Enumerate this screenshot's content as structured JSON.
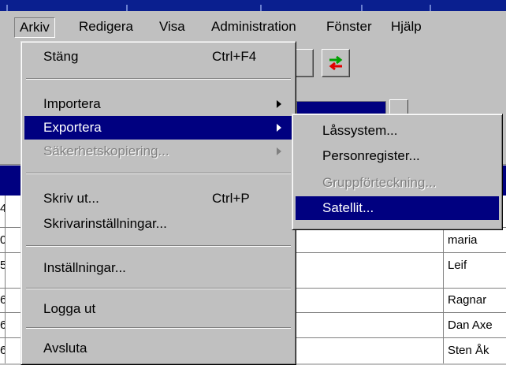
{
  "menubar": {
    "items": [
      "Arkiv",
      "Redigera",
      "Visa",
      "Administration",
      "Fönster",
      "Hjälp"
    ],
    "active": "Arkiv"
  },
  "arkiv_menu": {
    "close": {
      "label": "Stäng",
      "shortcut": "Ctrl+F4"
    },
    "import": {
      "label": "Importera"
    },
    "export": {
      "label": "Exportera"
    },
    "backup": {
      "label": "Säkerhetskopiering..."
    },
    "print": {
      "label": "Skriv ut...",
      "shortcut": "Ctrl+P"
    },
    "printer_settings": {
      "label": "Skrivarinställningar..."
    },
    "settings": {
      "label": "Inställningar..."
    },
    "logout": {
      "label": "Logga ut"
    },
    "exit": {
      "label": "Avsluta"
    }
  },
  "export_submenu": {
    "lock_system": "Låssystem...",
    "person_register": "Personregister...",
    "group_listing": "Gruppförteckning...",
    "satellite": "Satellit..."
  },
  "grid": {
    "row_prefix_fragments": [
      "4",
      "0",
      "5",
      "6",
      "6",
      "6"
    ],
    "name_cells": [
      "maria",
      "Leif",
      "Ragnar",
      "Dan Axe",
      "Sten Åk"
    ]
  },
  "colors": {
    "highlight": "#000080",
    "face": "#c0c0c0",
    "toolbar_arrow_green": "#00a000",
    "toolbar_arrow_red": "#e00000"
  },
  "icons": [
    "swap-arrows-icon",
    "submenu-arrow-icon"
  ]
}
